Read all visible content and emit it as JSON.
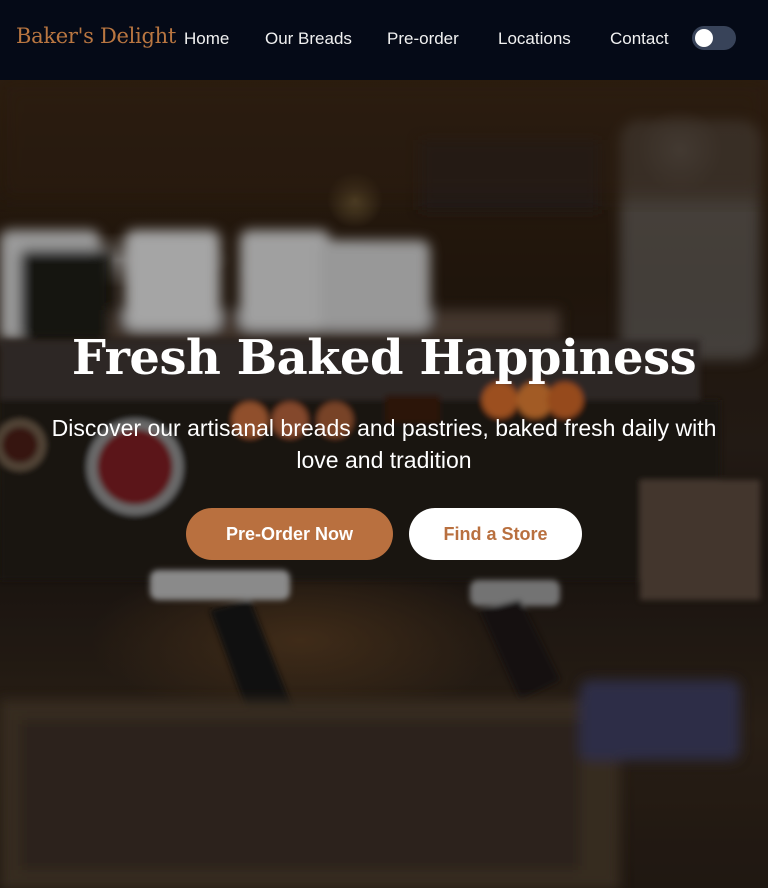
{
  "brand": {
    "name": "Baker's Delight"
  },
  "nav": {
    "links": [
      "Home",
      "Our Breads",
      "Pre-order",
      "Locations",
      "Contact"
    ]
  },
  "theme_toggle": {
    "state": "off"
  },
  "hero": {
    "title": "Fresh Baked Happiness",
    "subtitle": "Discover our artisanal breads and pastries, baked fresh daily with love and tradition",
    "primary_button": "Pre-Order Now",
    "secondary_button": "Find a Store"
  },
  "colors": {
    "accent": "#b9703f",
    "nav_background": "#050a17",
    "toggle_track": "#384359"
  }
}
